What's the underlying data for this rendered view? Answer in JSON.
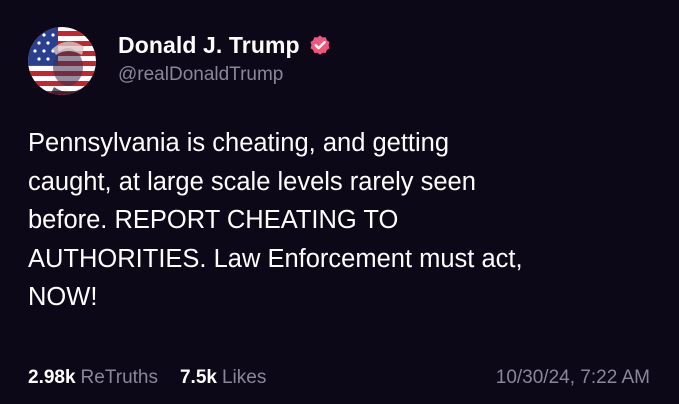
{
  "author": {
    "display_name": "Donald J. Trump",
    "handle": "@realDonaldTrump",
    "avatar_icon": "flag-portrait-avatar",
    "verified_icon": "verified-badge-icon",
    "verified_color": "#f0567a"
  },
  "post": {
    "text": "Pennsylvania is cheating, and getting\ncaught, at large scale levels rarely seen\nbefore. REPORT CHEATING TO\nAUTHORITIES. Law Enforcement must act,\nNOW!"
  },
  "stats": {
    "retruths_count": "2.98k",
    "retruths_label": "ReTruths",
    "likes_count": "7.5k",
    "likes_label": "Likes",
    "timestamp": "10/30/24, 7:22 AM"
  },
  "colors": {
    "background": "#0c0817",
    "primary_text": "#ffffff",
    "secondary_text": "#8b8698"
  }
}
